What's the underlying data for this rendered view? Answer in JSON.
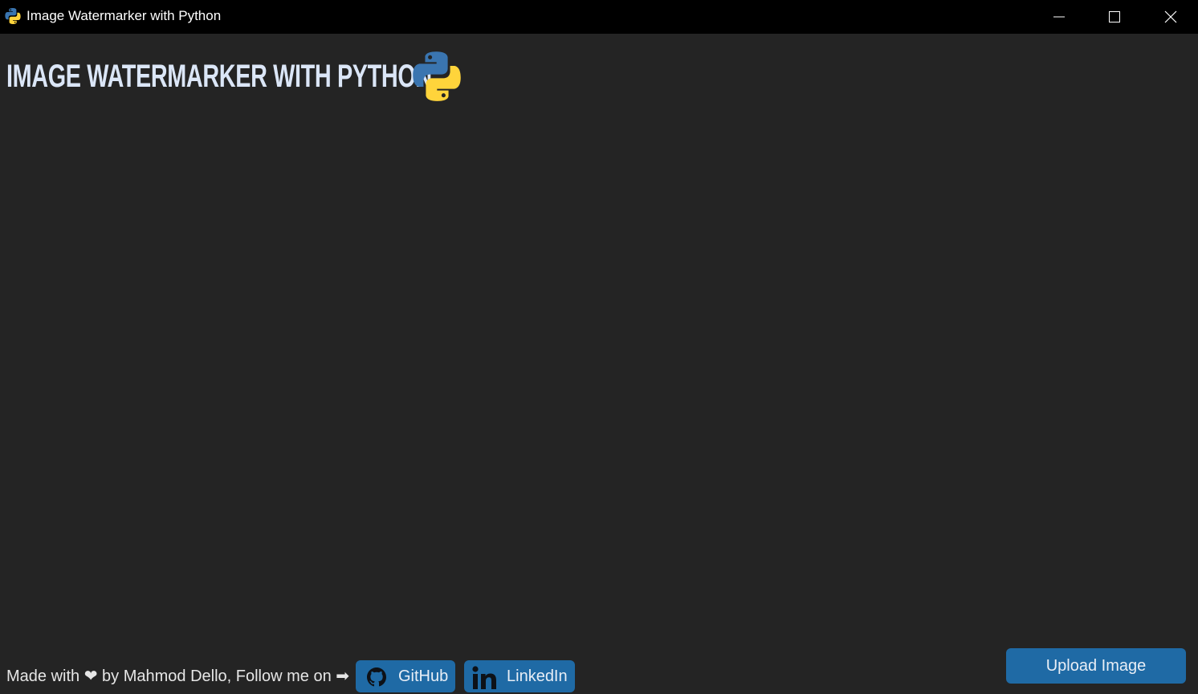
{
  "window": {
    "title": "Image Watermarker with Python",
    "controls": [
      "minimize-icon",
      "maximize-icon",
      "close-icon"
    ]
  },
  "header": {
    "heading": "IMAGE WATERMARKER WITH PYTHON",
    "logo_icon": "python-logo-icon"
  },
  "footer": {
    "credit_text": "Made with ❤ by Mahmod Dello, Follow me on ➡",
    "github_label": "GitHub",
    "github_icon": "github-icon",
    "linkedin_label": "LinkedIn",
    "linkedin_icon": "linkedin-icon"
  },
  "actions": {
    "upload_label": "Upload Image"
  },
  "colors": {
    "background": "#242424",
    "titlebar": "#000000",
    "button": "#1f6aa5",
    "heading_text": "#dbe6f7",
    "python_blue": "#3a75b0",
    "python_yellow": "#ffd43b"
  }
}
